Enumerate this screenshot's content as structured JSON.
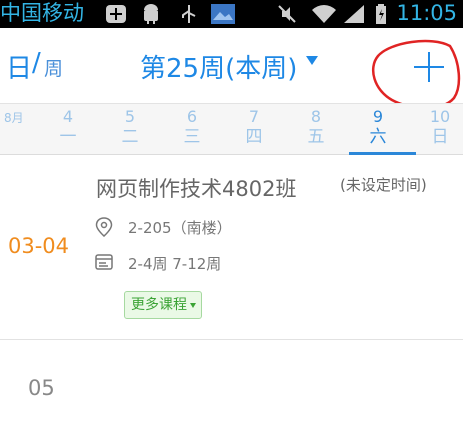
{
  "status_bar": {
    "carrier": "中国移动",
    "time": "11:05",
    "icons": [
      "notification-icon",
      "android-icon",
      "usb-icon",
      "image-icon",
      "mute-icon",
      "wifi-icon",
      "signal-icon",
      "battery-icon"
    ]
  },
  "toolbar": {
    "view_day": "日",
    "view_sep": "/",
    "view_week": "周",
    "week_title": "第25周(本周)",
    "add_icon": "plus-icon"
  },
  "days_strip": {
    "month": "8月",
    "days": [
      {
        "num": "4",
        "weekday": "一"
      },
      {
        "num": "5",
        "weekday": "二"
      },
      {
        "num": "6",
        "weekday": "三"
      },
      {
        "num": "7",
        "weekday": "四"
      },
      {
        "num": "8",
        "weekday": "五"
      },
      {
        "num": "9",
        "weekday": "六"
      },
      {
        "num": "10",
        "weekday": "日"
      }
    ],
    "selected": "9"
  },
  "course": {
    "time_slot": "03-04",
    "title": "网页制作技术4802班",
    "note": "(未设定时间)",
    "location": "2-205（南楼）",
    "schedule": "2-4周 7-12周",
    "more_label": "更多课程"
  },
  "next_slot": "05",
  "colors": {
    "accent": "#1e88e5",
    "time_orange": "#f08c1e",
    "green": "#3ba335"
  }
}
